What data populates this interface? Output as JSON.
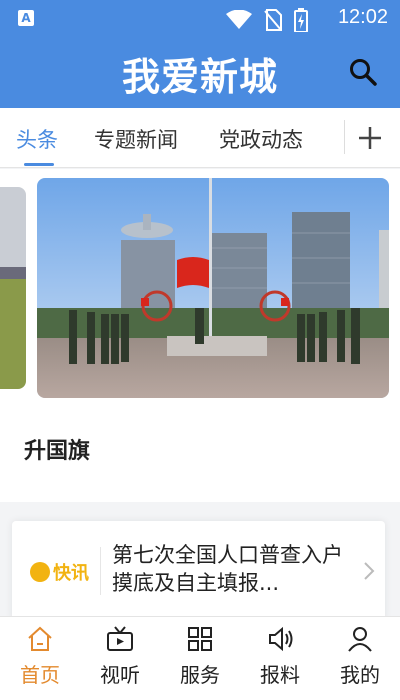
{
  "status_bar": {
    "app_icon_letter": "A",
    "time": "12:02"
  },
  "header": {
    "title": "我爱新城"
  },
  "tabs": [
    {
      "label": "头条",
      "active": true
    },
    {
      "label": "专题新闻",
      "active": false
    },
    {
      "label": "党政动态",
      "active": false
    }
  ],
  "banner": {
    "caption": "升国旗"
  },
  "flash_news": {
    "badge": "快讯",
    "text": "第七次全国人口普查入户摸底及自主填报..."
  },
  "bottom_nav": [
    {
      "label": "首页",
      "icon": "home-icon",
      "active": true
    },
    {
      "label": "视听",
      "icon": "tv-icon",
      "active": false
    },
    {
      "label": "服务",
      "icon": "grid-icon",
      "active": false
    },
    {
      "label": "报料",
      "icon": "speaker-icon",
      "active": false
    },
    {
      "label": "我的",
      "icon": "user-icon",
      "active": false
    }
  ],
  "colors": {
    "brand_blue": "#4a8be0",
    "active_orange": "#e38a2e",
    "flash_yellow": "#f2b311"
  }
}
